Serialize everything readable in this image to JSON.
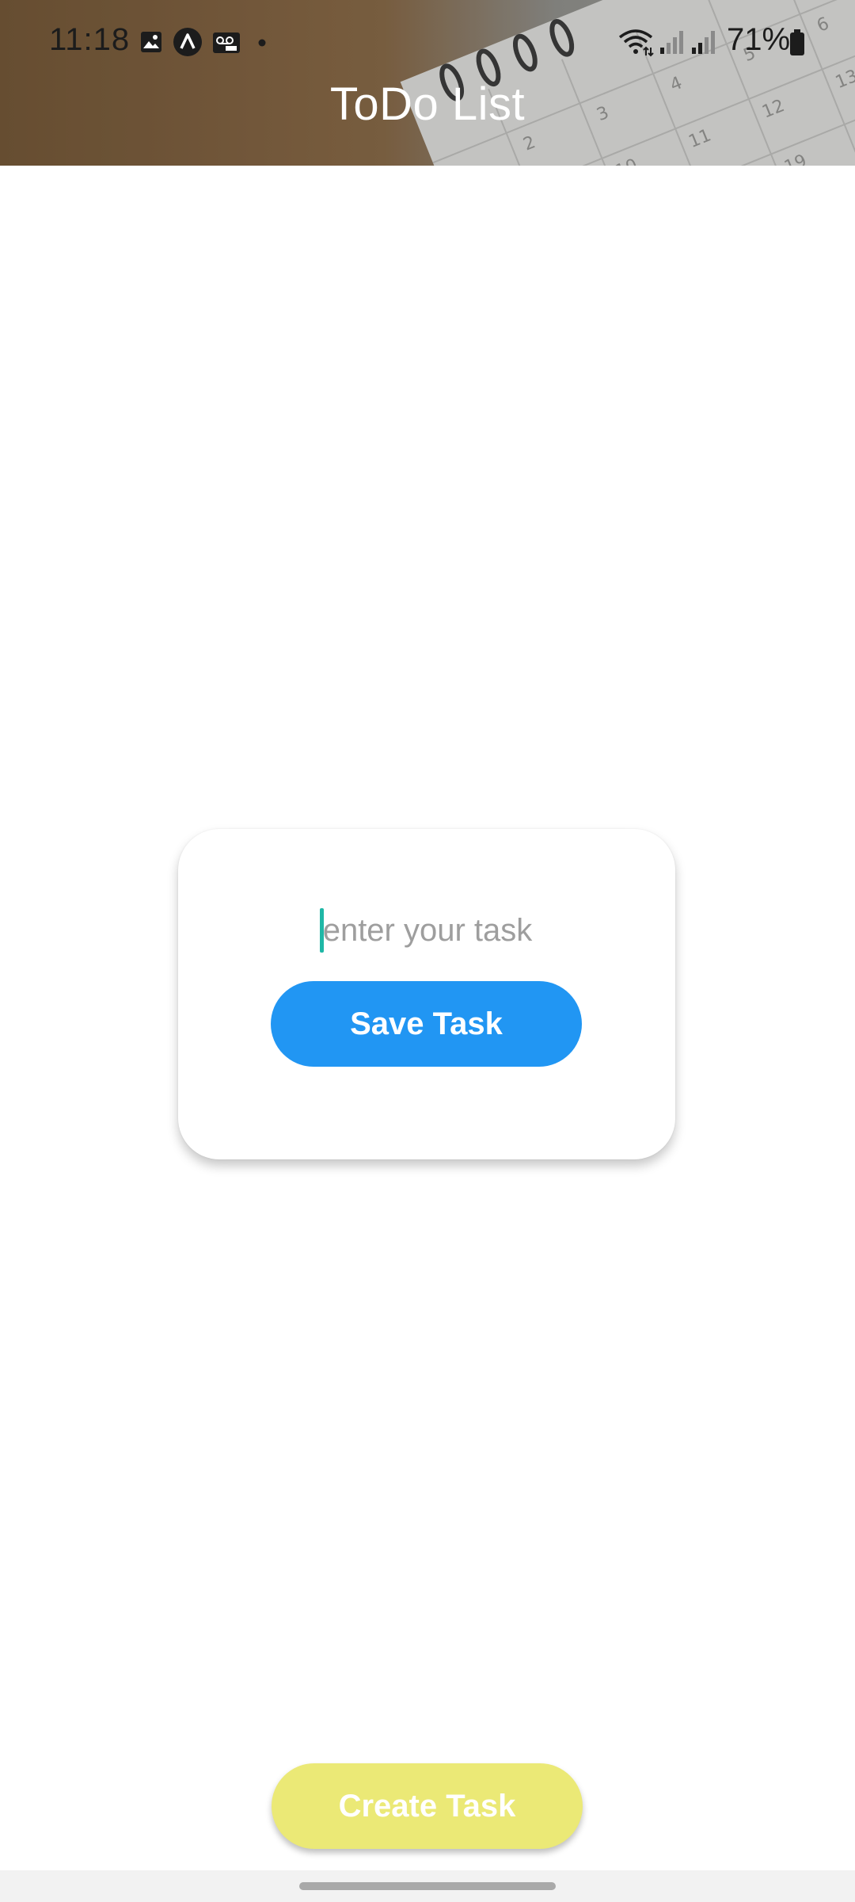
{
  "status_bar": {
    "time": "11:18",
    "battery_percent": "71%",
    "icons": [
      "gallery-icon",
      "app-launcher-icon",
      "voicemail-icon",
      "notification-dot-icon",
      "wifi-icon",
      "signal-icon",
      "signal-icon",
      "battery-icon"
    ]
  },
  "header": {
    "title": "ToDo List"
  },
  "task_card": {
    "input_placeholder": "enter your task",
    "input_value": "",
    "save_label": "Save Task"
  },
  "footer": {
    "create_label": "Create Task"
  },
  "colors": {
    "save_button": "#2196f3",
    "create_button": "#ebe976",
    "cursor": "#1fb7a6",
    "title_text": "#ffffff"
  }
}
